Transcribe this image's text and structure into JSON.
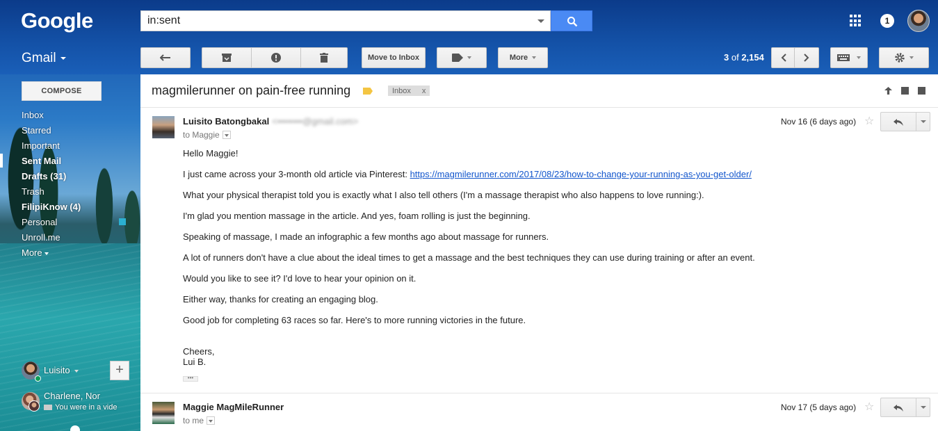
{
  "header": {
    "logo": "Google",
    "search_value": "in:sent",
    "notification_count": "1"
  },
  "toolbar": {
    "gmail_label": "Gmail",
    "move_to_inbox": "Move to Inbox",
    "more": "More",
    "pager_current": "3",
    "pager_of": "of",
    "pager_total": "2,154"
  },
  "sidebar": {
    "compose": "COMPOSE",
    "items": [
      {
        "label": "Inbox",
        "bold": false
      },
      {
        "label": "Starred",
        "bold": false
      },
      {
        "label": "Important",
        "bold": false
      },
      {
        "label": "Sent Mail",
        "bold": true
      },
      {
        "label": "Drafts (31)",
        "bold": true
      },
      {
        "label": "Trash",
        "bold": false
      },
      {
        "label": "FilipiKnow (4)",
        "bold": true
      },
      {
        "label": "Personal",
        "bold": false
      },
      {
        "label": "Unroll.me",
        "bold": false
      },
      {
        "label": "More",
        "bold": false
      }
    ],
    "hangouts": {
      "self_name": "Luisito",
      "contact_name": "Charlene, Nor",
      "contact_status": "You were in a vide"
    }
  },
  "thread": {
    "subject": "magmilerunner on pain-free running",
    "label_chip": "Inbox",
    "label_chip_close": "x",
    "messages": [
      {
        "sender": "Luisito Batongbakal",
        "sender_email_blurred": "<••••••••@gmail.com>",
        "to": "to Maggie",
        "date": "Nov 16 (6 days ago)",
        "body": [
          "Hello Maggie!",
          "I just came across your 3-month old article via Pinterest: ",
          "What your physical therapist told you is exactly what I also tell others (I'm a massage therapist who also happens to love running:).",
          "I'm glad you mention massage in the article. And yes, foam rolling is just the beginning.",
          "Speaking of massage, I made an infographic a few months ago about massage for runners.",
          "A lot of runners don't have a clue about the ideal times to get a massage and the best techniques they can use during training or after an event.",
          "Would you like to see it? I'd love to hear your opinion on it.",
          "Either way, thanks for creating an engaging blog.",
          "Good job for completing 63 races so far. Here's to more running victories in the future."
        ],
        "link": "https://magmilerunner.com/2017/08/23/how-to-change-your-running-as-you-get-older/",
        "sign_off": "Cheers,",
        "signature": "Lui B.",
        "trimmed": "•••"
      },
      {
        "sender": "Maggie MagMileRunner",
        "to": "to me",
        "date": "Nov 17 (5 days ago)"
      }
    ]
  }
}
